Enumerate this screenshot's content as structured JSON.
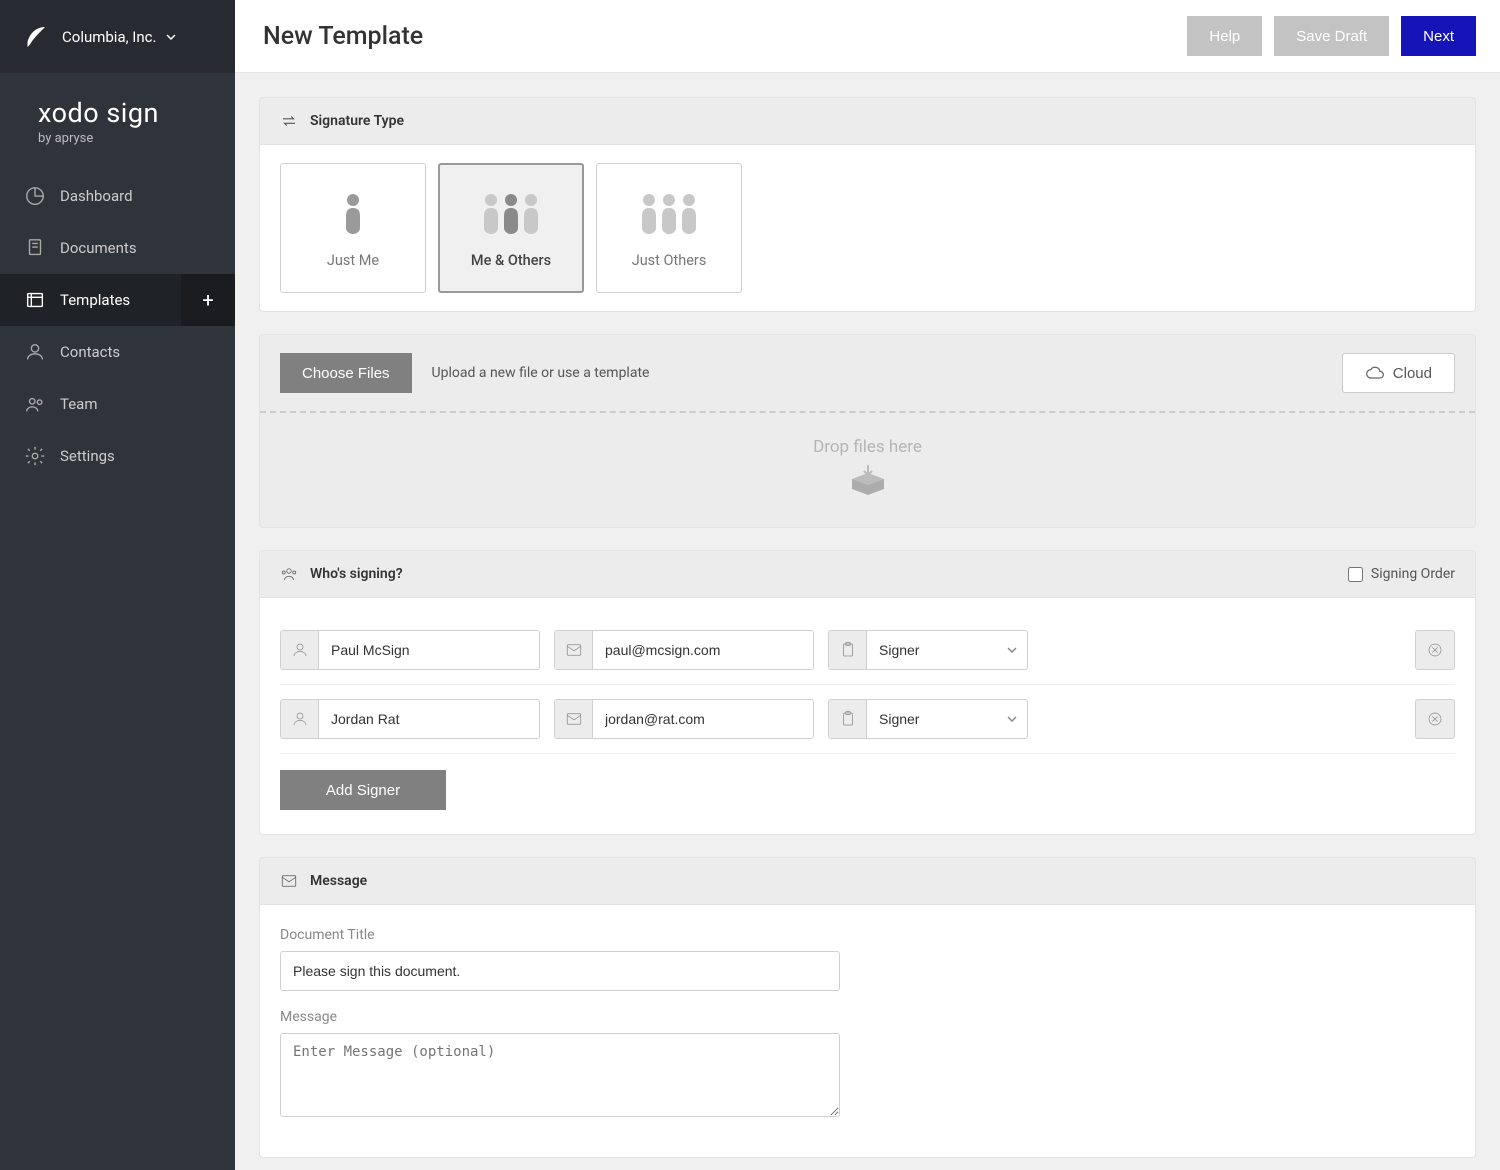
{
  "org": {
    "name": "Columbia, Inc."
  },
  "brand": {
    "title": "xodo sign",
    "subtitle": "by apryse"
  },
  "sidebar": {
    "items": [
      {
        "label": "Dashboard"
      },
      {
        "label": "Documents"
      },
      {
        "label": "Templates"
      },
      {
        "label": "Contacts"
      },
      {
        "label": "Team"
      },
      {
        "label": "Settings"
      }
    ]
  },
  "header": {
    "title": "New Template",
    "help": "Help",
    "save_draft": "Save Draft",
    "next": "Next"
  },
  "signature_type": {
    "title": "Signature Type",
    "options": [
      {
        "label": "Just Me"
      },
      {
        "label": "Me & Others"
      },
      {
        "label": "Just Others"
      }
    ]
  },
  "upload": {
    "choose": "Choose Files",
    "hint": "Upload a new file or use a template",
    "cloud": "Cloud",
    "drop": "Drop files here"
  },
  "signing": {
    "title": "Who's signing?",
    "order_label": "Signing Order",
    "add_signer": "Add Signer",
    "signers": [
      {
        "name": "Paul McSign",
        "email": "paul@mcsign.com",
        "role": "Signer"
      },
      {
        "name": "Jordan Rat",
        "email": "jordan@rat.com",
        "role": "Signer"
      }
    ]
  },
  "message": {
    "title": "Message",
    "doc_title_label": "Document Title",
    "doc_title_value": "Please sign this document.",
    "msg_label": "Message",
    "msg_placeholder": "Enter Message (optional)"
  }
}
